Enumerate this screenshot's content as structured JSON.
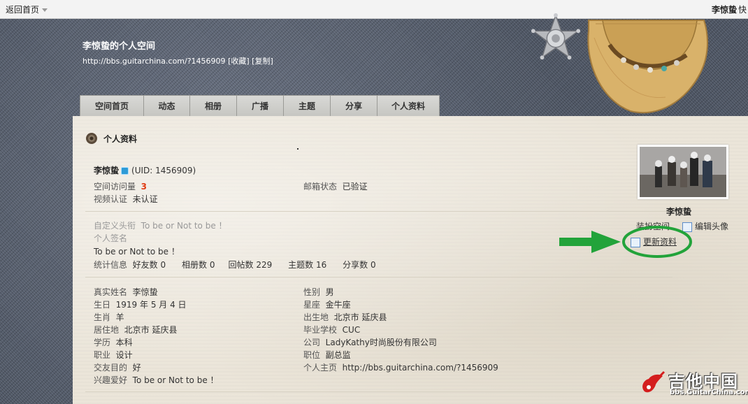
{
  "topbar": {
    "home_link": "返回首页",
    "username": "李惊蛰",
    "more_text": "快"
  },
  "space": {
    "title": "李惊蛰的个人空间",
    "url": "http://bbs.guitarchina.com/?1456909",
    "bookmark_label": "[收藏]",
    "copy_label": "[复制]"
  },
  "nav": {
    "tabs": [
      "空间首页",
      "动态",
      "相册",
      "广播",
      "主题",
      "分享",
      "个人资料"
    ]
  },
  "profile": {
    "section_title": "个人资料",
    "name": "李惊蛰",
    "uid_text": "(UID: 1456909)",
    "visits_label": "空间访问量",
    "visits_value": "3",
    "email_label": "邮箱状态",
    "email_value": "已验证",
    "video_label": "视频认证",
    "video_value": "未认证",
    "custom_title_label": "自定义头衔",
    "custom_title_value": "To be or Not to be ！",
    "signature_label": "个人签名",
    "signature_value": "To be or Not to be ！",
    "stats_label": "统计信息",
    "stats": [
      "好友数 0",
      "相册数 0",
      "回帖数 229",
      "主题数 16",
      "分享数 0"
    ]
  },
  "details": {
    "left": [
      {
        "label": "真实姓名",
        "value": "李惊蛰"
      },
      {
        "label": "生日",
        "value": "1919 年 5 月 4 日"
      },
      {
        "label": "生肖",
        "value": "羊"
      },
      {
        "label": "居住地",
        "value": "北京市 延庆县"
      },
      {
        "label": "学历",
        "value": "本科"
      },
      {
        "label": "职业",
        "value": "设计"
      },
      {
        "label": "交友目的",
        "value": "好"
      },
      {
        "label": "兴趣爱好",
        "value": "To be or Not to be ！"
      }
    ],
    "right": [
      {
        "label": "性别",
        "value": "男"
      },
      {
        "label": "星座",
        "value": "金牛座"
      },
      {
        "label": "出生地",
        "value": "北京市 延庆县"
      },
      {
        "label": "毕业学校",
        "value": "CUC"
      },
      {
        "label": "公司",
        "value": "LadyKathy时尚股份有限公司"
      },
      {
        "label": "职位",
        "value": "副总监"
      },
      {
        "label": "个人主页",
        "value": "http://bbs.guitarchina.com/?1456909"
      }
    ]
  },
  "sidebar": {
    "name": "李惊蛰",
    "action_partial": "装扮空间",
    "edit_avatar": "编辑头像",
    "update_profile": "更新资料"
  },
  "watermark": {
    "brand": "吉他中国",
    "site": "bbs.GuitarChina.com"
  },
  "colors": {
    "arrow_green": "#22a33a",
    "visits_red": "#e03a12"
  }
}
